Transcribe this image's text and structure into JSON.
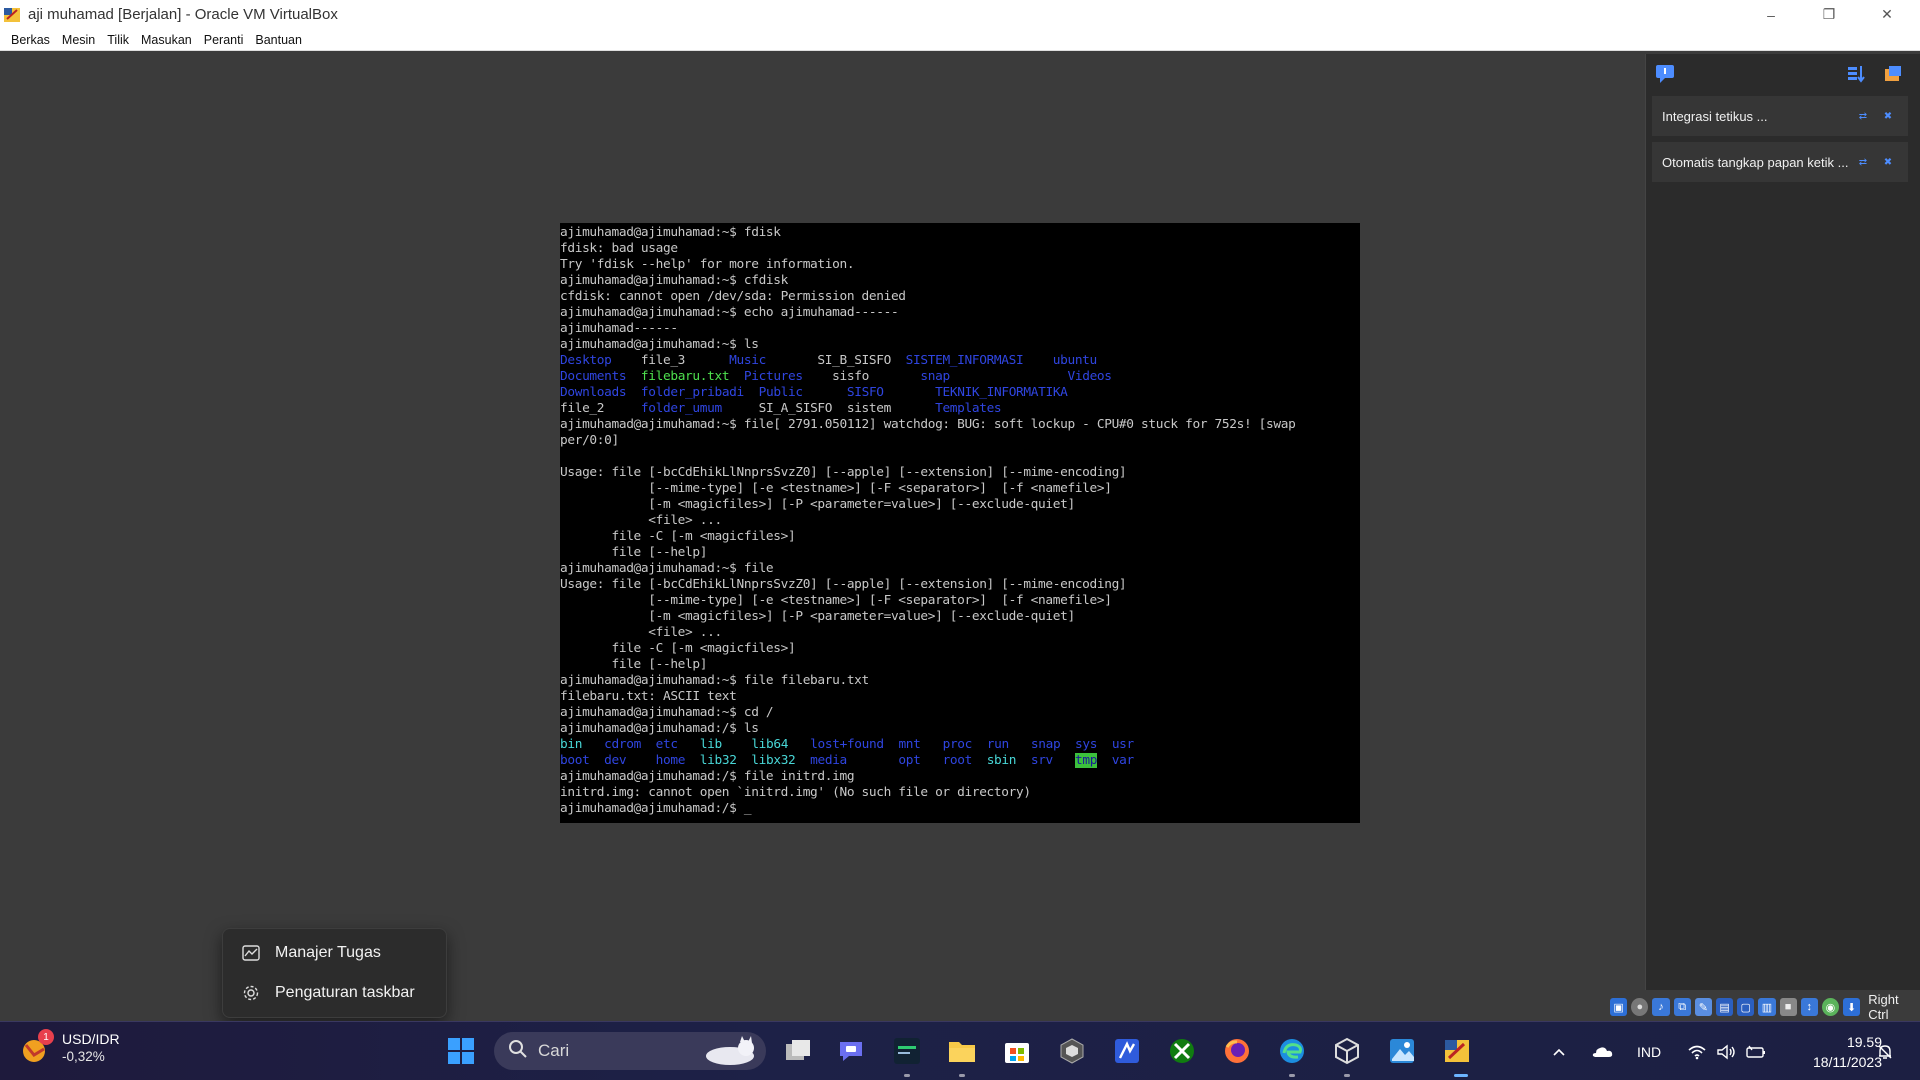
{
  "window": {
    "title": "aji muhamad  [Berjalan] - Oracle VM VirtualBox",
    "controls": {
      "minimize": "–",
      "restore": "❐",
      "close": "✕"
    }
  },
  "menubar": {
    "items": [
      "Berkas",
      "Mesin",
      "Tilik",
      "Masukan",
      "Peranti",
      "Bantuan"
    ]
  },
  "terminal": {
    "lines": [
      [
        {
          "t": "ajimuhamad@ajimuhamad:~$ fdisk"
        }
      ],
      [
        {
          "t": "fdisk: bad usage"
        }
      ],
      [
        {
          "t": "Try 'fdisk --help' for more information."
        }
      ],
      [
        {
          "t": "ajimuhamad@ajimuhamad:~$ cfdisk"
        }
      ],
      [
        {
          "t": "cfdisk: cannot open /dev/sda: Permission denied"
        }
      ],
      [
        {
          "t": "ajimuhamad@ajimuhamad:~$ echo ajimuhamad------"
        }
      ],
      [
        {
          "t": "ajimuhamad------"
        }
      ],
      [
        {
          "t": "ajimuhamad@ajimuhamad:~$ ls"
        }
      ],
      [
        {
          "t": "Desktop",
          "c": "blue"
        },
        {
          "t": "    file_3      "
        },
        {
          "t": "Music",
          "c": "blue"
        },
        {
          "t": "       SI_B_SISFO  "
        },
        {
          "t": "SISTEM_INFORMASI",
          "c": "blue"
        },
        {
          "t": "    "
        },
        {
          "t": "ubuntu",
          "c": "blue"
        }
      ],
      [
        {
          "t": "Documents",
          "c": "blue"
        },
        {
          "t": "  "
        },
        {
          "t": "filebaru.txt",
          "c": "green"
        },
        {
          "t": "  "
        },
        {
          "t": "Pictures",
          "c": "blue"
        },
        {
          "t": "    sisfo       "
        },
        {
          "t": "snap",
          "c": "blue"
        },
        {
          "t": "                "
        },
        {
          "t": "Videos",
          "c": "blue"
        }
      ],
      [
        {
          "t": "Downloads",
          "c": "blue"
        },
        {
          "t": "  "
        },
        {
          "t": "folder_pribadi",
          "c": "blue"
        },
        {
          "t": "  "
        },
        {
          "t": "Public",
          "c": "blue"
        },
        {
          "t": "      "
        },
        {
          "t": "SISFO",
          "c": "blue"
        },
        {
          "t": "       "
        },
        {
          "t": "TEKNIK_INFORMATIKA",
          "c": "blue"
        }
      ],
      [
        {
          "t": "file_2     "
        },
        {
          "t": "folder_umum",
          "c": "blue"
        },
        {
          "t": "     SI_A_SISFO  sistem      "
        },
        {
          "t": "Templates",
          "c": "blue"
        }
      ],
      [
        {
          "t": "ajimuhamad@ajimuhamad:~$ file[ 2791.050112] watchdog: BUG: soft lockup - CPU#0 stuck for 752s! [swap"
        }
      ],
      [
        {
          "t": "per/0:0]"
        }
      ],
      [
        {
          "t": ""
        }
      ],
      [
        {
          "t": "Usage: file [-bcCdEhikLlNnprsSvzZ0] [--apple] [--extension] [--mime-encoding]"
        }
      ],
      [
        {
          "t": "            [--mime-type] [-e <testname>] [-F <separator>]  [-f <namefile>]"
        }
      ],
      [
        {
          "t": "            [-m <magicfiles>] [-P <parameter=value>] [--exclude-quiet]"
        }
      ],
      [
        {
          "t": "            <file> ..."
        }
      ],
      [
        {
          "t": "       file -C [-m <magicfiles>]"
        }
      ],
      [
        {
          "t": "       file [--help]"
        }
      ],
      [
        {
          "t": "ajimuhamad@ajimuhamad:~$ file"
        }
      ],
      [
        {
          "t": "Usage: file [-bcCdEhikLlNnprsSvzZ0] [--apple] [--extension] [--mime-encoding]"
        }
      ],
      [
        {
          "t": "            [--mime-type] [-e <testname>] [-F <separator>]  [-f <namefile>]"
        }
      ],
      [
        {
          "t": "            [-m <magicfiles>] [-P <parameter=value>] [--exclude-quiet]"
        }
      ],
      [
        {
          "t": "            <file> ..."
        }
      ],
      [
        {
          "t": "       file -C [-m <magicfiles>]"
        }
      ],
      [
        {
          "t": "       file [--help]"
        }
      ],
      [
        {
          "t": "ajimuhamad@ajimuhamad:~$ file filebaru.txt"
        }
      ],
      [
        {
          "t": "filebaru.txt: ASCII text"
        }
      ],
      [
        {
          "t": "ajimuhamad@ajimuhamad:~$ cd /"
        }
      ],
      [
        {
          "t": "ajimuhamad@ajimuhamad:/$ ls"
        }
      ],
      [
        {
          "t": "bin",
          "c": "cyan"
        },
        {
          "t": "   "
        },
        {
          "t": "cdrom",
          "c": "blue"
        },
        {
          "t": "  "
        },
        {
          "t": "etc",
          "c": "blue"
        },
        {
          "t": "   "
        },
        {
          "t": "lib",
          "c": "cyan"
        },
        {
          "t": "    "
        },
        {
          "t": "lib64",
          "c": "cyan"
        },
        {
          "t": "   "
        },
        {
          "t": "lost+found",
          "c": "blue"
        },
        {
          "t": "  "
        },
        {
          "t": "mnt",
          "c": "blue"
        },
        {
          "t": "   "
        },
        {
          "t": "proc",
          "c": "blue"
        },
        {
          "t": "  "
        },
        {
          "t": "run",
          "c": "blue"
        },
        {
          "t": "   "
        },
        {
          "t": "snap",
          "c": "blue"
        },
        {
          "t": "  "
        },
        {
          "t": "sys",
          "c": "blue"
        },
        {
          "t": "  "
        },
        {
          "t": "usr",
          "c": "blue"
        }
      ],
      [
        {
          "t": "boot",
          "c": "blue"
        },
        {
          "t": "  "
        },
        {
          "t": "dev",
          "c": "blue"
        },
        {
          "t": "    "
        },
        {
          "t": "home",
          "c": "blue"
        },
        {
          "t": "  "
        },
        {
          "t": "lib32",
          "c": "cyan"
        },
        {
          "t": "  "
        },
        {
          "t": "libx32",
          "c": "cyan"
        },
        {
          "t": "  "
        },
        {
          "t": "media",
          "c": "blue"
        },
        {
          "t": "       "
        },
        {
          "t": "opt",
          "c": "blue"
        },
        {
          "t": "   "
        },
        {
          "t": "root",
          "c": "blue"
        },
        {
          "t": "  "
        },
        {
          "t": "sbin",
          "c": "cyan"
        },
        {
          "t": "  "
        },
        {
          "t": "srv",
          "c": "blue"
        },
        {
          "t": "   "
        },
        {
          "t": "tmp",
          "c": "tmp"
        },
        {
          "t": "  "
        },
        {
          "t": "var",
          "c": "blue"
        }
      ],
      [
        {
          "t": "ajimuhamad@ajimuhamad:/$ file initrd.img"
        }
      ],
      [
        {
          "t": "initrd.img: cannot open `initrd.img' (No such file or directory)"
        }
      ],
      [
        {
          "t": "ajimuhamad@ajimuhamad:/$ "
        },
        {
          "t": "_",
          "c": "cursor"
        }
      ]
    ]
  },
  "side_panel": {
    "notifications": [
      {
        "label": "Integrasi tetikus ..."
      },
      {
        "label": "Otomatis tangkap papan ketik ..."
      }
    ]
  },
  "vm_status": {
    "host_key": "Right Ctrl"
  },
  "context_menu": {
    "items": [
      {
        "label": "Manajer Tugas",
        "icon": "task-manager-icon"
      },
      {
        "label": "Pengaturan taskbar",
        "icon": "gear-icon"
      }
    ]
  },
  "taskbar": {
    "widget": {
      "title": "USD/IDR",
      "value": "-0,32%",
      "badge": "1"
    },
    "search_placeholder": "Cari",
    "tray": {
      "language": "IND"
    },
    "clock": {
      "time": "19.59",
      "date": "18/11/2023"
    },
    "colors": {
      "accent": "#0067c0",
      "windows_logo": "#3aa0ff"
    }
  }
}
